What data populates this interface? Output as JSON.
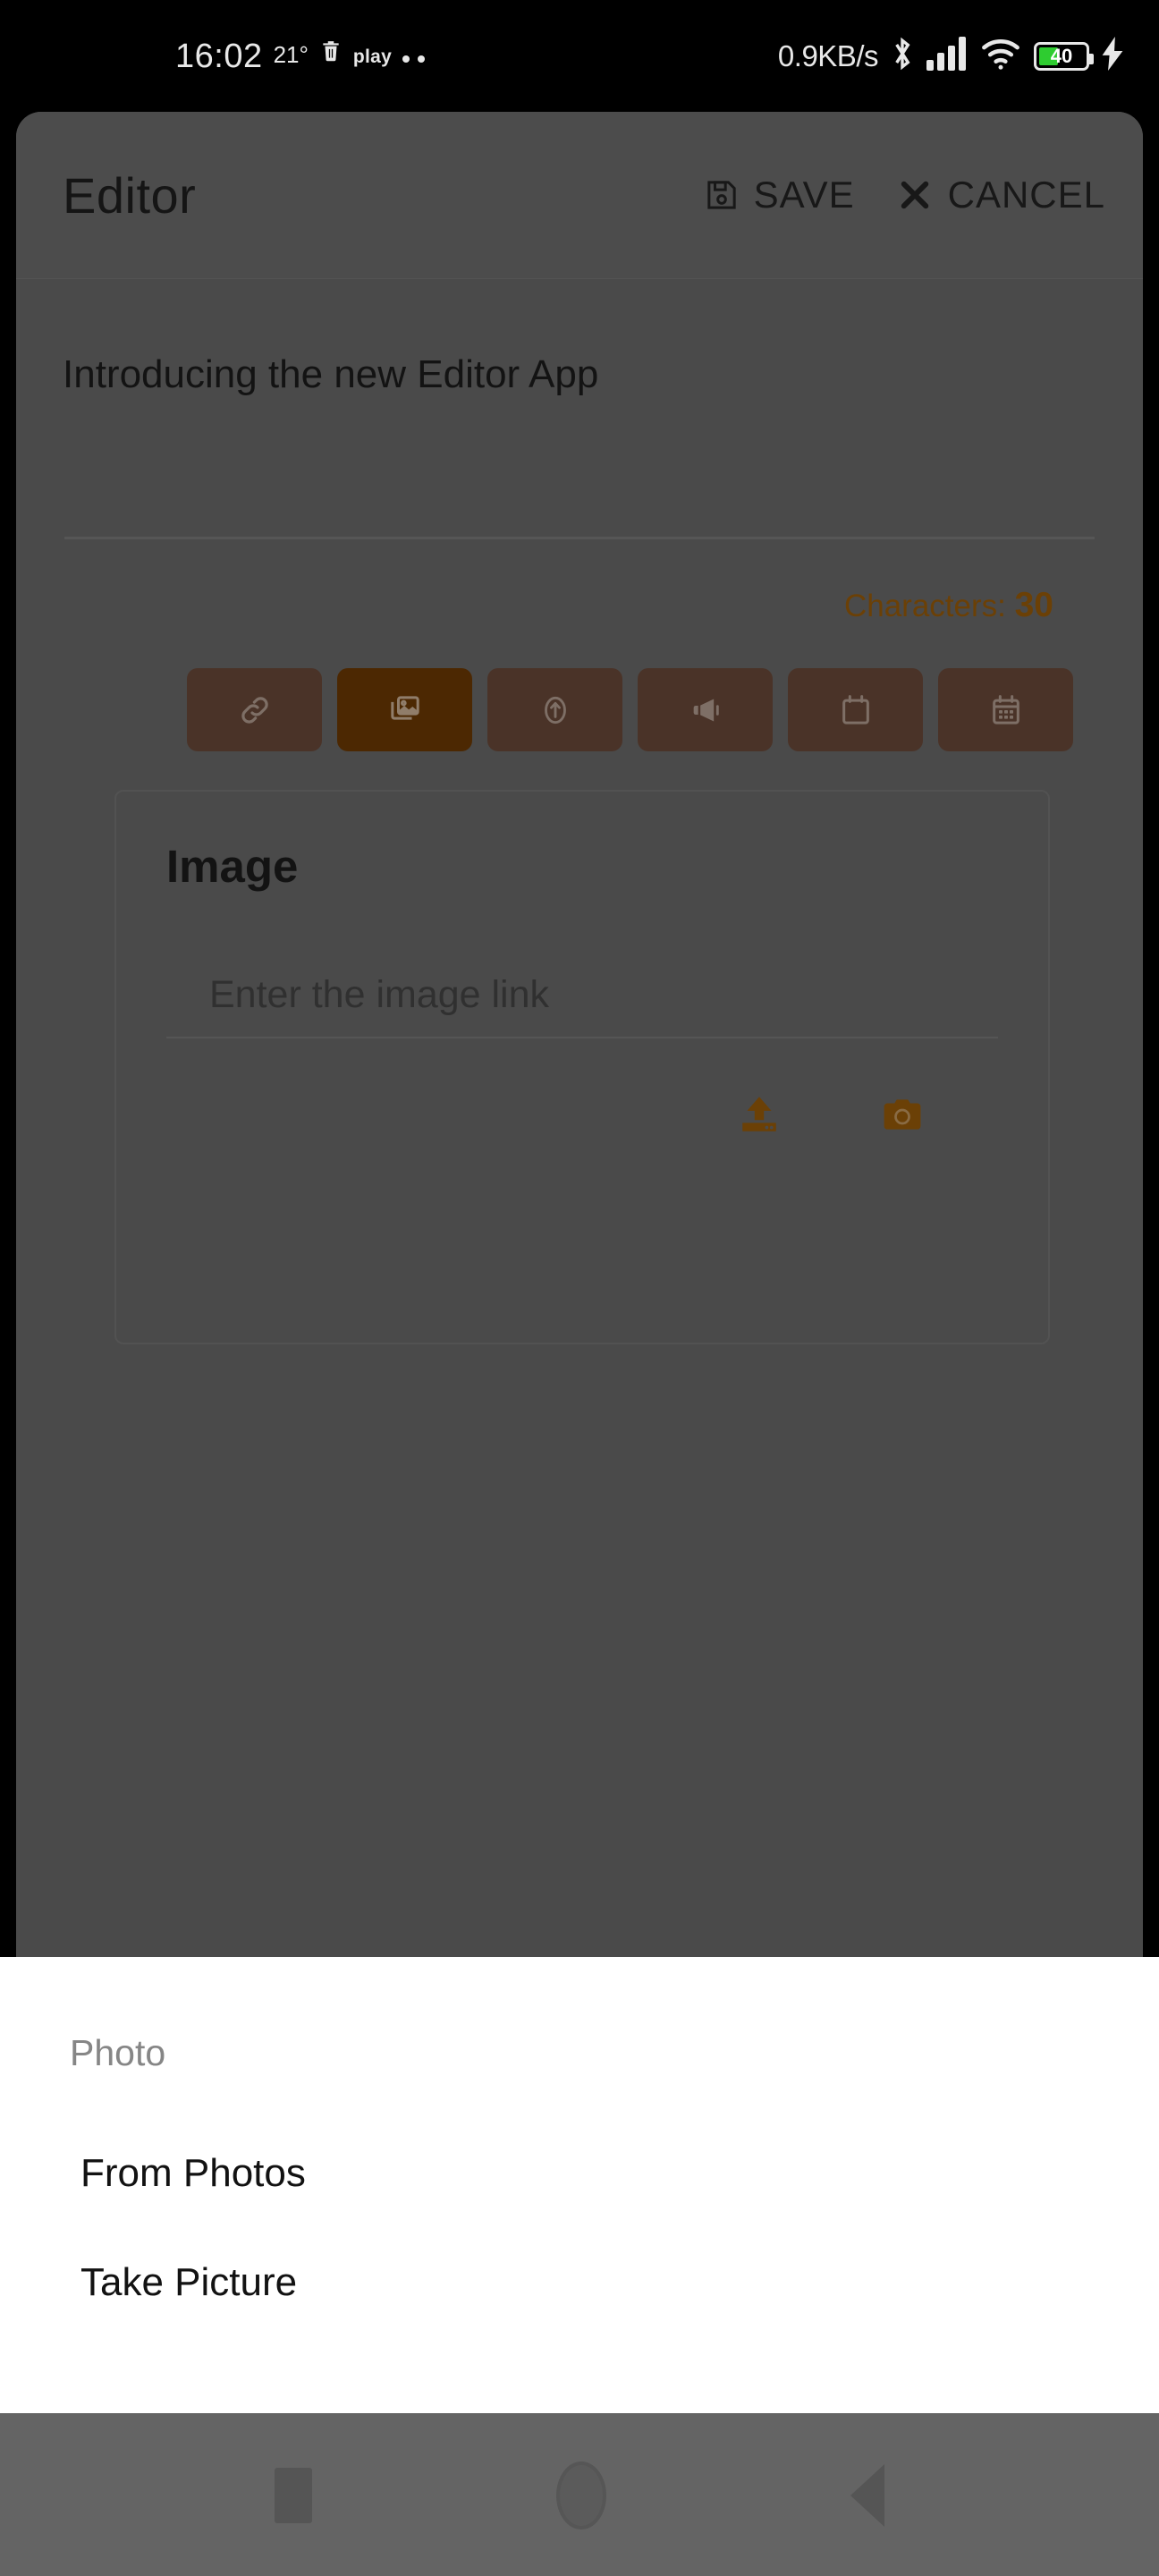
{
  "status_bar": {
    "clock": "16:02",
    "temperature": "21°",
    "trash_icon": "trash-icon",
    "play_label": "play",
    "more_dots": "more-dots-icon",
    "network_speed": "0.9KB/s",
    "bluetooth_icon": "bluetooth-icon",
    "signal_icon": "cellular-signal-icon",
    "wifi_icon": "wifi-icon",
    "battery_level": "40",
    "charging_icon": "charging-bolt-icon"
  },
  "app_bar": {
    "title": "Editor",
    "save_label": "SAVE",
    "save_icon": "floppy-disk-icon",
    "cancel_label": "CANCEL",
    "cancel_icon": "close-x-icon"
  },
  "editor": {
    "document_title": "Introducing the new Editor App",
    "character_label": "Characters:",
    "character_count": "30",
    "accent_color": "#9a5c0a"
  },
  "toolbar": {
    "buttons": [
      {
        "name": "link-button",
        "icon": "link-icon",
        "active": false
      },
      {
        "name": "image-button",
        "icon": "image-gallery-icon",
        "active": true
      },
      {
        "name": "upload-button",
        "icon": "upload-circle-icon",
        "active": false
      },
      {
        "name": "announcement-button",
        "icon": "megaphone-icon",
        "active": false
      },
      {
        "name": "event-button",
        "icon": "calendar-icon",
        "active": false
      },
      {
        "name": "schedule-button",
        "icon": "calendar-grid-icon",
        "active": false
      }
    ],
    "active_color": "#6d3a04",
    "inactive_color": "#6b4a3a"
  },
  "image_card": {
    "title": "Image",
    "link_placeholder": "Enter the image link",
    "link_value": "",
    "upload_icon": "upload-icon",
    "camera_icon": "camera-icon"
  },
  "bottom_sheet": {
    "title": "Photo",
    "options": [
      {
        "label": "From Photos",
        "name": "sheet-option-from-photos"
      },
      {
        "label": "Take Picture",
        "name": "sheet-option-take-picture"
      }
    ]
  },
  "nav_bar": {
    "recents_icon": "recents-square-icon",
    "home_icon": "home-circle-icon",
    "back_icon": "back-triangle-icon"
  }
}
